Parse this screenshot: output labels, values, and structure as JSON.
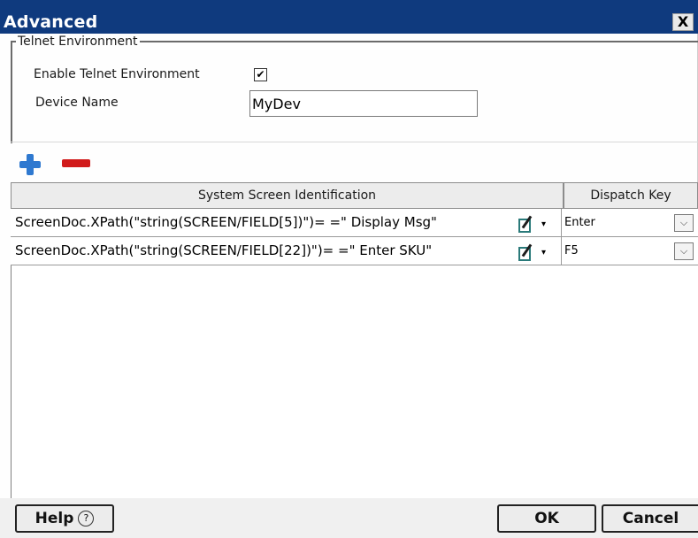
{
  "window": {
    "title": "Advanced",
    "close_glyph": "X"
  },
  "telnet": {
    "legend": "Telnet Environment",
    "enable_label": "Enable Telnet Environment",
    "enable_checked_glyph": "✔",
    "device_label": "Device Name",
    "device_value": "MyDev"
  },
  "toolbar": {
    "add_icon": "plus-icon",
    "remove_icon": "minus-icon"
  },
  "grid": {
    "headers": [
      "System Screen Identification",
      "Dispatch Key"
    ],
    "rows": [
      {
        "expression": "ScreenDoc.XPath(\"string(SCREEN/FIELD[5])\")= =\" Display Msg\"",
        "key": "Enter"
      },
      {
        "expression": "ScreenDoc.XPath(\"string(SCREEN/FIELD[22])\")= =\" Enter SKU\"",
        "key": "F5"
      }
    ],
    "edit_icon": "edit-expression-icon",
    "caret_glyph": "▾",
    "dropdown_glyph": "⌵"
  },
  "buttons": {
    "help_label": "Help",
    "help_glyph": "?",
    "ok_label": "OK",
    "cancel_label": "Cancel"
  }
}
